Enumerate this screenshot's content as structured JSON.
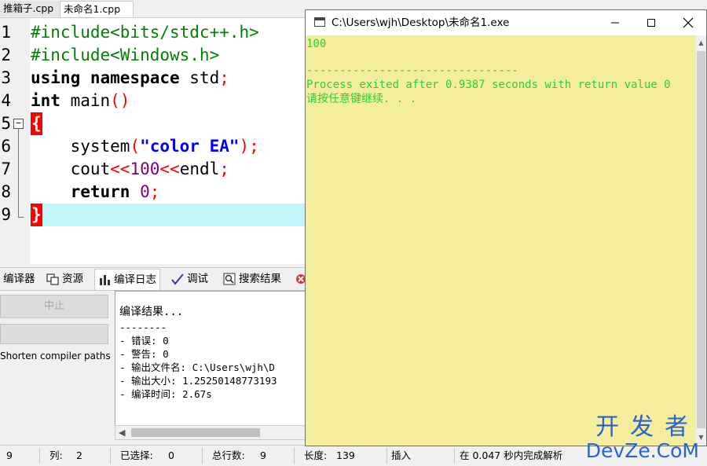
{
  "editor_tabs": [
    {
      "label": "推箱子.cpp"
    },
    {
      "label": "未命名1.cpp"
    }
  ],
  "line_numbers": [
    "1",
    "2",
    "3",
    "4",
    "5",
    "6",
    "7",
    "8",
    "9"
  ],
  "code": {
    "l1": "#include<bits/stdc++.h>",
    "l2": "#include<Windows.h>",
    "l3_kw": "using namespace",
    "l3_id": " std",
    "l3_semi": ";",
    "l4_kw": "int",
    "l4_id": " main",
    "l4_paren": "()",
    "l5_brace": "{",
    "l6_id": "    system",
    "l6_open": "(",
    "l6_str": "\"color EA\"",
    "l6_close": ");",
    "l7_id": "    cout",
    "l7_op1": "<<",
    "l7_num": "100",
    "l7_op2": "<<",
    "l7_id2": "endl",
    "l7_semi": ";",
    "l8_kw": "    return",
    "l8_num": " 0",
    "l8_semi": ";",
    "l9_brace": "}"
  },
  "bottom_tabs": [
    {
      "label": "编译器"
    },
    {
      "label": "资源"
    },
    {
      "label": "编译日志"
    },
    {
      "label": "调试"
    },
    {
      "label": "搜索结果"
    }
  ],
  "left_controls": {
    "abort_label": "中止",
    "shorten_label": "Shorten compiler paths"
  },
  "log_lines": [
    "编译结果...",
    "--------",
    "- 错误: 0",
    "- 警告: 0",
    "- 输出文件名: C:\\Users\\wjh\\D",
    "- 输出大小: 1.25250148773193",
    "- 编译时间: 2.67s"
  ],
  "status": {
    "row_value": "9",
    "col_label": "列:",
    "col_value": "2",
    "sel_label": "已选择:",
    "sel_value": "0",
    "total_label": "总行数:",
    "total_value": "9",
    "len_label": "长度:",
    "len_value": "139",
    "mode": "插入",
    "parse_msg": "在 0.047 秒内完成解析"
  },
  "console": {
    "title": "C:\\Users\\wjh\\Desktop\\未命名1.exe",
    "lines": [
      "100",
      "",
      "--------------------------------",
      "Process exited after 0.9387 seconds with return value 0",
      "请按任意键继续. . ."
    ],
    "bg_color": "#f5ed9e",
    "text_color": "#33cc33"
  },
  "watermark": {
    "top": "开发者",
    "bottom": "DevZe.CoM"
  },
  "window_icons": [
    "minimize-icon",
    "maximize-icon",
    "close-icon"
  ]
}
